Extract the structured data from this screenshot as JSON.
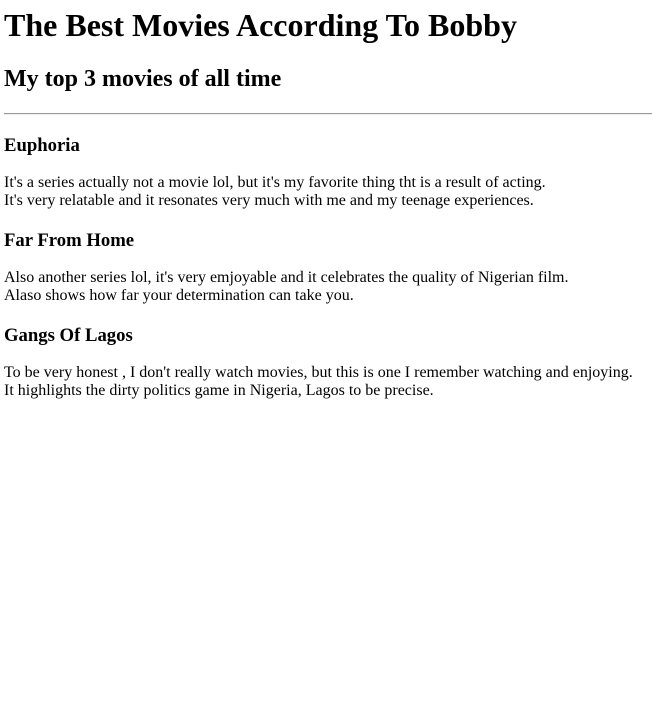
{
  "header": {
    "title": "The Best Movies According To Bobby",
    "subtitle": "My top 3 movies of all time"
  },
  "movies": [
    {
      "title": "Euphoria",
      "line1": "It's a series actually not a movie lol, but it's my favorite thing tht is a result of acting.",
      "line2": "It's very relatable and it resonates very much with me and my teenage experiences."
    },
    {
      "title": "Far From Home",
      "line1": "Also another series lol, it's very emjoyable and it celebrates the quality of Nigerian film.",
      "line2": "Alaso shows how far your determination can take you."
    },
    {
      "title": "Gangs Of Lagos",
      "line1": "To be very honest , I don't really watch movies, but this is one I remember watching and enjoying.",
      "line2": "It highlights the dirty politics game in Nigeria, Lagos to be precise."
    }
  ]
}
